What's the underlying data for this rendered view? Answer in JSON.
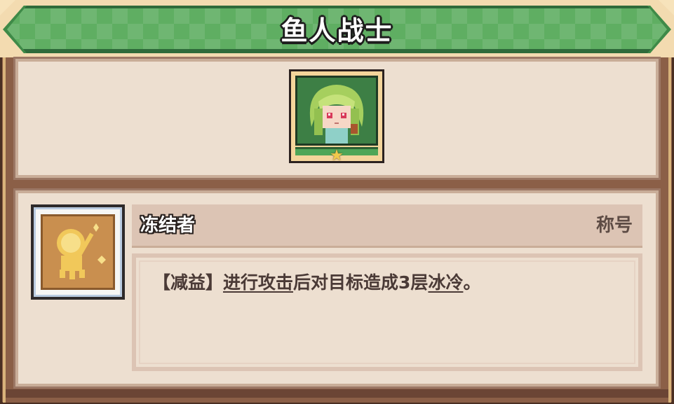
{
  "header": {
    "title": "鱼人战士"
  },
  "portrait": {
    "icon": "mermaid-warrior-portrait",
    "stars": "★"
  },
  "title_card": {
    "icon": "frozen-figure-icon",
    "name": "冻结者",
    "tag": "称号",
    "description": {
      "prefix": "【减益】",
      "kw1": "进行攻击",
      "middle": "后对目标造成3层",
      "kw2": "冰冷",
      "suffix": "。"
    }
  },
  "colors": {
    "banner_green": "#5fae62",
    "panel_bg": "#eddfd0",
    "frame_brown": "#8a5e46"
  }
}
